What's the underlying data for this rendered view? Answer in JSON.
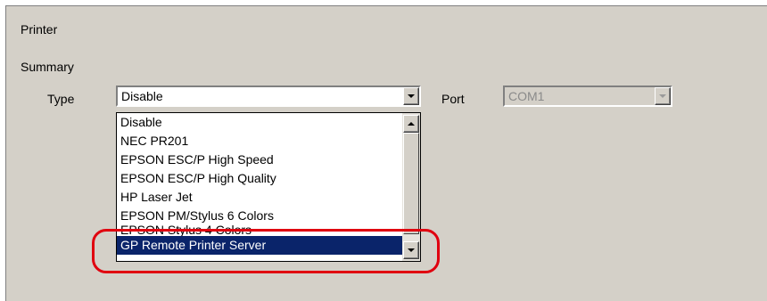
{
  "panel": {
    "title": "Printer"
  },
  "summary": {
    "title": "Summary",
    "type_label": "Type",
    "type_value": "Disable",
    "port_label": "Port",
    "port_value": "COM1"
  },
  "dropdown": {
    "items": [
      "Disable",
      "NEC PR201",
      "EPSON ESC/P High Speed",
      "EPSON ESC/P High Quality",
      "HP Laser Jet",
      "EPSON PM/Stylus 6 Colors",
      "EPSON Stylus 4 Colors",
      "GP Remote Printer Server"
    ],
    "selected_item": "GP Remote Printer Server"
  },
  "colors": {
    "selection": "#0a246a",
    "highlight_ring": "#e0000f",
    "panel_bg": "#d4d0c8"
  }
}
